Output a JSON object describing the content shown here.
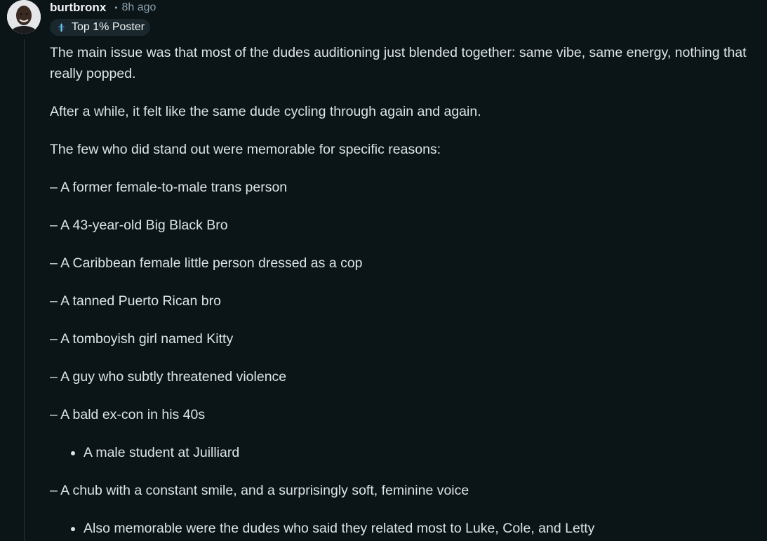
{
  "comment": {
    "username": "burtbronx",
    "separator": "•",
    "time_ago": "8h ago",
    "badge": {
      "label": "Top 1% Poster",
      "icon": "flair-icon"
    },
    "avatar": "avatar-photo",
    "paragraphs": [
      "The main issue was that most of the dudes auditioning just blended together: same vibe, same energy, nothing that really popped.",
      "After a while, it felt like the same dude cycling through again and again.",
      "The few who did stand out were memorable for specific reasons:",
      "– A former female-to-male trans person",
      "– A 43-year-old Big Black Bro",
      "– A Caribbean female little person dressed as a cop",
      "– A tanned Puerto Rican bro",
      "– A tomboyish girl named Kitty",
      "– A guy who subtly threatened violence",
      "– A bald ex-con in his 40s"
    ],
    "bullet_1": "A male student at Juilliard",
    "paragraph_after_bullet": "– A chub with a constant smile, and a surprisingly soft, feminine voice",
    "bullet_2": "Also memorable were the dudes who said they related most to Luke, Cole, and Letty"
  },
  "colors": {
    "background": "#0b1416",
    "text": "#dde4e8",
    "muted": "#8ba2ad",
    "badge_bg": "#1a282d"
  }
}
